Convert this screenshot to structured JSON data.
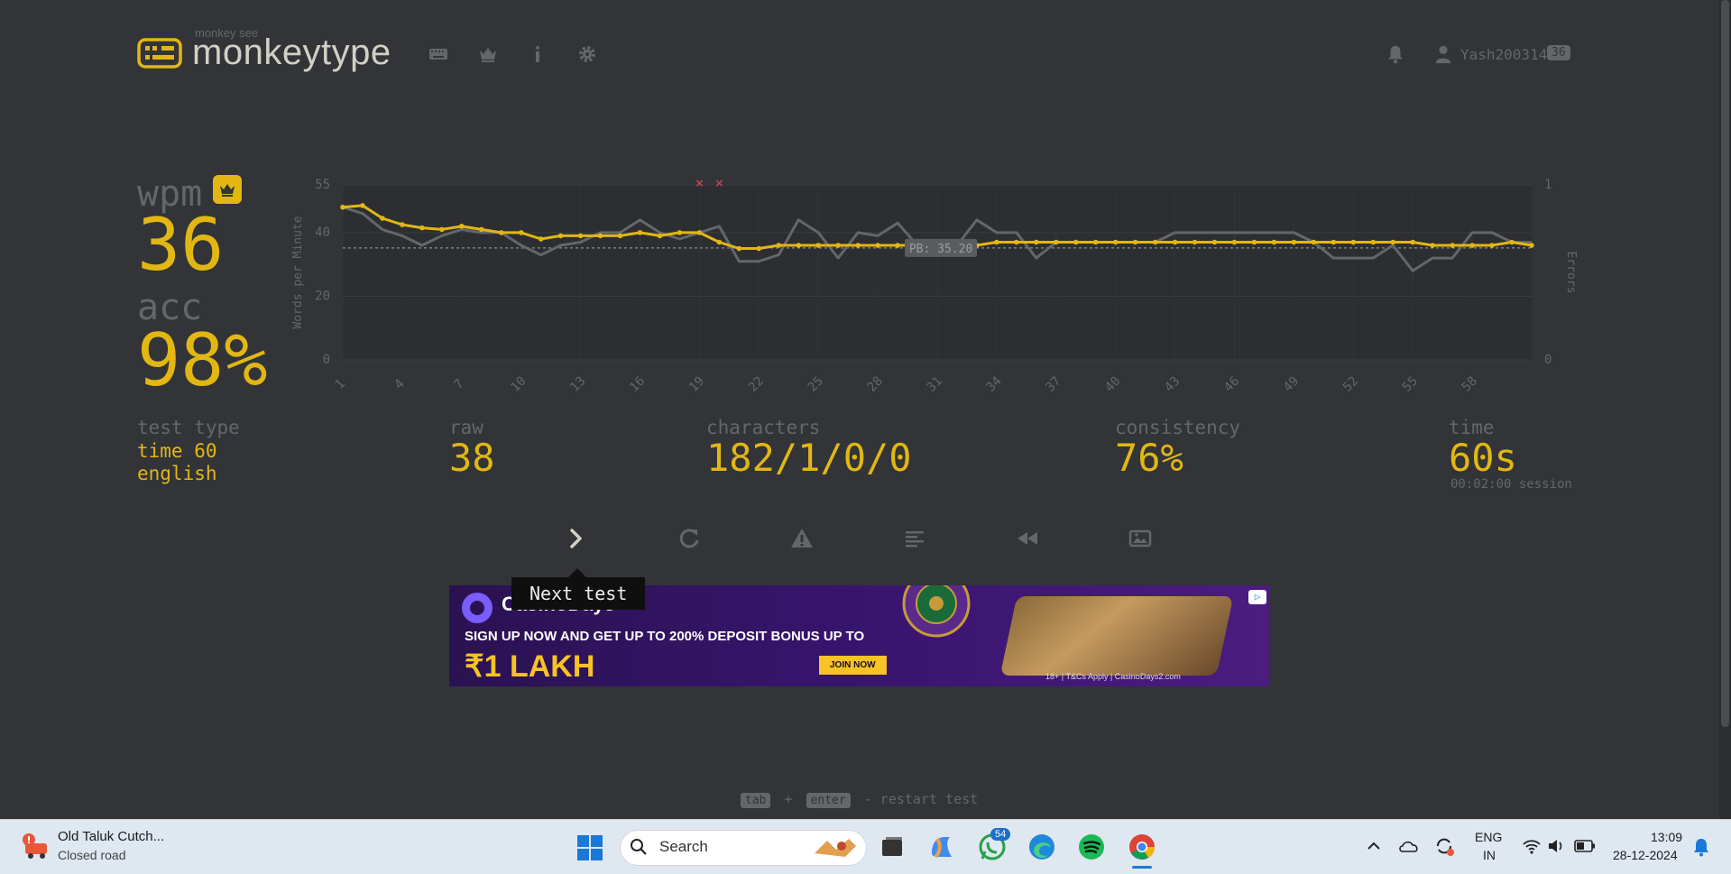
{
  "header": {
    "logo_small": "monkey see",
    "logo_text": "monkeytype",
    "nav_icons": [
      "keyboard-icon",
      "crown-icon",
      "info-icon",
      "gear-icon"
    ],
    "user": {
      "name": "Yash200314",
      "level": "36"
    }
  },
  "result": {
    "wpm_label": "wpm",
    "wpm_value": "36",
    "acc_label": "acc",
    "acc_value": "98%",
    "test_type_label": "test type",
    "test_type_mode": "time 60",
    "test_type_language": "english",
    "raw_label": "raw",
    "raw_value": "38",
    "characters_label": "characters",
    "characters_value": "182/1/0/0",
    "consistency_label": "consistency",
    "consistency_value": "76%",
    "time_label": "time",
    "time_value": "60s",
    "session_value": "00:02:00 session"
  },
  "chart_data": {
    "type": "line",
    "ylabel": "Words per Minute",
    "y2label": "Errors",
    "ylim": [
      0,
      55
    ],
    "y2lim": [
      0,
      1
    ],
    "yticks": [
      "0",
      "20",
      "40",
      "55"
    ],
    "y2ticks": [
      "0",
      "1"
    ],
    "xticks": [
      "1",
      "4",
      "7",
      "10",
      "13",
      "16",
      "19",
      "22",
      "25",
      "28",
      "31",
      "34",
      "37",
      "40",
      "43",
      "46",
      "49",
      "52",
      "55",
      "58"
    ],
    "pb_label": "PB: 35.20",
    "pb_value": 35.2,
    "error_seconds": [
      19,
      20
    ],
    "series": [
      {
        "name": "wpm",
        "color": "#e2b714",
        "values": [
          48,
          48.5,
          44.5,
          42.5,
          41.5,
          41,
          42,
          41,
          40,
          40,
          38,
          39,
          39,
          39,
          39,
          40,
          39,
          40,
          40,
          37,
          35,
          35,
          36,
          36,
          36,
          36,
          36,
          36,
          36,
          36,
          36,
          36,
          36,
          37,
          37,
          37,
          37,
          37,
          37,
          37,
          37,
          37,
          37,
          37,
          37,
          37,
          37,
          37,
          37,
          37,
          37,
          37,
          37,
          37,
          37,
          36,
          36,
          36,
          36,
          37,
          36
        ]
      },
      {
        "name": "raw",
        "color": "#646669",
        "values": [
          48,
          46,
          41,
          39,
          36,
          39,
          41,
          40,
          40,
          36,
          33,
          36,
          37,
          40,
          40,
          44,
          40,
          38,
          40,
          42,
          31,
          31,
          33,
          44,
          40,
          32,
          40,
          39,
          43,
          36,
          36,
          36,
          44,
          40,
          40,
          32,
          37,
          37,
          37,
          37,
          37,
          37,
          40,
          40,
          40,
          40,
          40,
          40,
          40,
          37,
          32,
          32,
          32,
          36,
          28,
          32,
          32,
          40,
          40,
          37,
          37
        ]
      }
    ]
  },
  "buttons": [
    {
      "name": "next-test-button",
      "icon": "chevron-right-icon"
    },
    {
      "name": "restart-button",
      "icon": "refresh-icon"
    },
    {
      "name": "report-button",
      "icon": "warning-icon"
    },
    {
      "name": "word-history-button",
      "icon": "text-align-icon"
    },
    {
      "name": "replay-button",
      "icon": "rewind-icon"
    },
    {
      "name": "screenshot-button",
      "icon": "image-icon"
    }
  ],
  "tooltip": "Next test",
  "ad": {
    "brand": "CasinoDays",
    "headline": "SIGN UP NOW AND GET UP TO 200% DEPOSIT BONUS UP TO",
    "amount": "₹1 LAKH",
    "cta": "JOIN NOW",
    "terms": "18+ | T&Cs Apply | CasinoDays2.com"
  },
  "footer": {
    "key1": "tab",
    "plus": "+",
    "key2": "enter",
    "hint": "- restart test"
  },
  "taskbar": {
    "weather_title": "Old Taluk Cutch...",
    "weather_sub": "Closed road",
    "search_placeholder": "Search",
    "whatsapp_badge": "54",
    "lang_line1": "ENG",
    "lang_line2": "IN",
    "time": "13:09",
    "date": "28-12-2024"
  }
}
